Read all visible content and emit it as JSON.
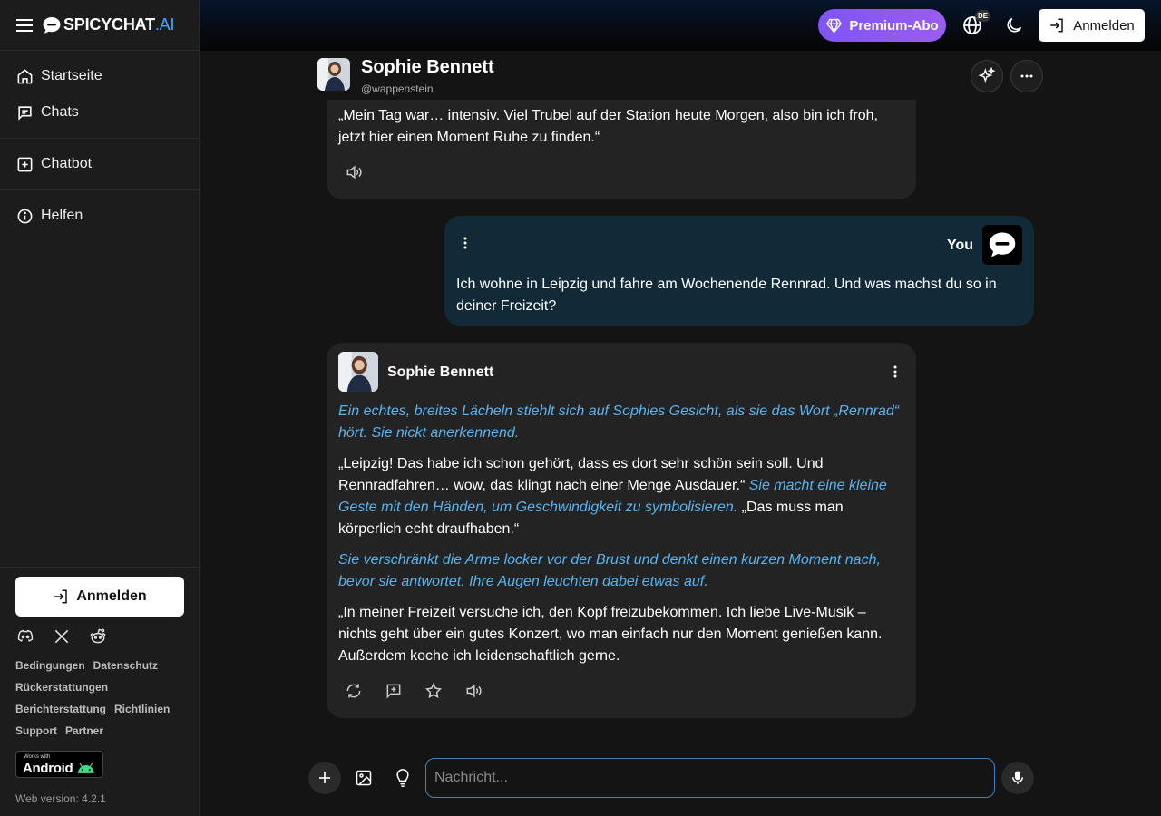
{
  "brand": {
    "name_main": "SPICYCHAT",
    "name_suffix": ".AI"
  },
  "sidebar": {
    "items": [
      {
        "label": "Startseite",
        "icon": "home-icon"
      },
      {
        "label": "Chats",
        "icon": "chat-icon"
      },
      {
        "label": "Chatbot",
        "icon": "add-box-icon"
      },
      {
        "label": "Helfen",
        "icon": "info-icon"
      }
    ],
    "login_label": "Anmelden",
    "socials": [
      "discord-icon",
      "x-icon",
      "reddit-icon"
    ],
    "links": [
      "Bedingungen",
      "Datenschutz",
      "Rückerstattungen",
      "Berichterstattung",
      "Richtlinien",
      "Support",
      "Partner"
    ],
    "android_small": "Works with",
    "android_big": "Android",
    "web_version": "Web version: 4.2.1"
  },
  "topbar": {
    "premium_label": "Premium-Abo",
    "language_badge": "DE",
    "login_label": "Anmelden",
    "colors": {
      "premium": "#8b58f3"
    }
  },
  "chat": {
    "name": "Sophie Bennett",
    "handle": "@wappenstein"
  },
  "messages": {
    "first_bot": "„Mein Tag war… intensiv. Viel Trubel auf der Station heute Morgen, also bin ich froh, jetzt hier einen Moment Ruhe zu finden.“",
    "user_name": "You",
    "user_text": "Ich wohne in Leipzig und fahre am Wochenende Rennrad. Und was machst du so in deiner Freizeit?",
    "bot_name": "Sophie Bennett",
    "p1_action": "Ein echtes, breites Lächeln stiehlt sich auf Sophies Gesicht, als sie das Wort „Rennrad“ hört. Sie nickt anerkennend.",
    "p2_speech_a": "„Leipzig! Das habe ich schon gehört, dass es dort sehr schön sein soll. Und Rennradfahren… wow, das klingt nach einer Menge Ausdauer.“",
    "p2_action": "Sie macht eine kleine Geste mit den Händen, um Geschwindigkeit zu symbolisieren.",
    "p2_speech_b": "„Das muss man körperlich echt draufhaben.“",
    "p3_action": "Sie verschränkt die Arme locker vor der Brust und denkt einen kurzen Moment nach, bevor sie antwortet. Ihre Augen leuchten dabei etwas auf.",
    "p4_speech": "„In meiner Freizeit versuche ich, den Kopf freizubekommen. Ich liebe Live-Musik – nichts geht über ein gutes Konzert, wo man einfach nur den Moment genießen kann. Außerdem koche ich leidenschaftlich gerne."
  },
  "input": {
    "placeholder": "Nachricht..."
  }
}
